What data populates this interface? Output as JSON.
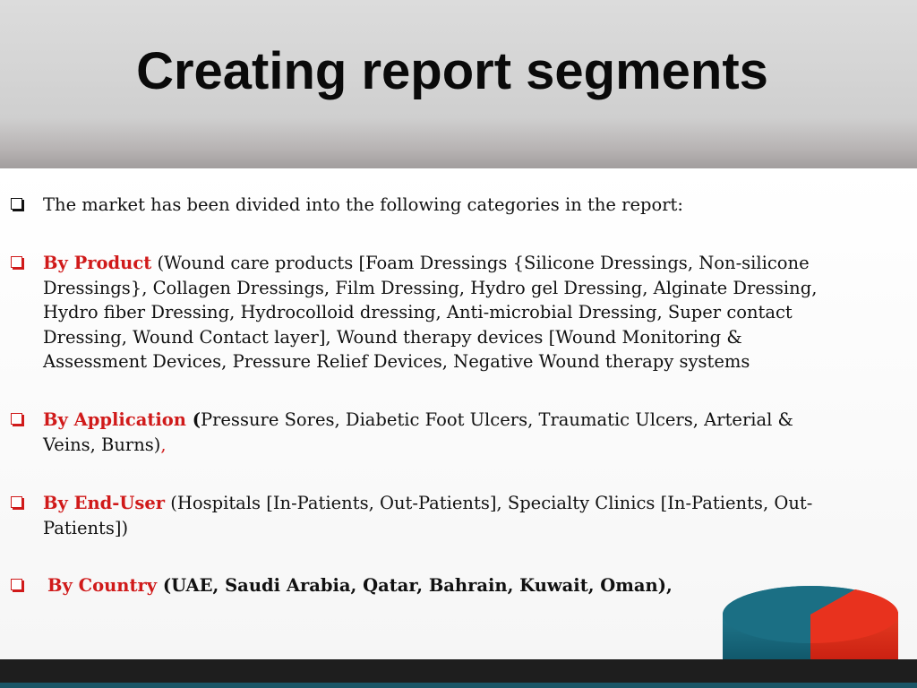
{
  "slide": {
    "title": "Creating report segments",
    "intro": "The market has been divided into the following categories in the report:",
    "product": {
      "label": "By Product",
      "text": " (Wound care products [Foam Dressings {Silicone Dressings, Non-silicone Dressings}, Collagen Dressings, Film Dressing, Hydro gel Dressing, Alginate Dressing, Hydro fiber Dressing, Hydrocolloid dressing, Anti-microbial Dressing, Super contact Dressing, Wound Contact layer], Wound therapy devices [Wound Monitoring & Assessment Devices, Pressure Relief Devices, Negative Wound therapy systems"
    },
    "application": {
      "label": "By Application",
      "open": " (",
      "text": "Pressure Sores, Diabetic Foot Ulcers, Traumatic Ulcers, Arterial & Veins, Burns)",
      "trail": ","
    },
    "enduser": {
      "label": "By End-User",
      "text": " (Hospitals [In-Patients, Out-Patients], Specialty Clinics [In-Patients, Out-Patients])"
    },
    "country": {
      "label": "By Country",
      "text": " (UAE, Saudi Arabia, Qatar, Bahrain, Kuwait, Oman),"
    }
  },
  "colors": {
    "accent": "#d01a1a",
    "pie_teal": "#1b6f84",
    "pie_red": "#e8321e",
    "footer": "#1e1e1e"
  }
}
